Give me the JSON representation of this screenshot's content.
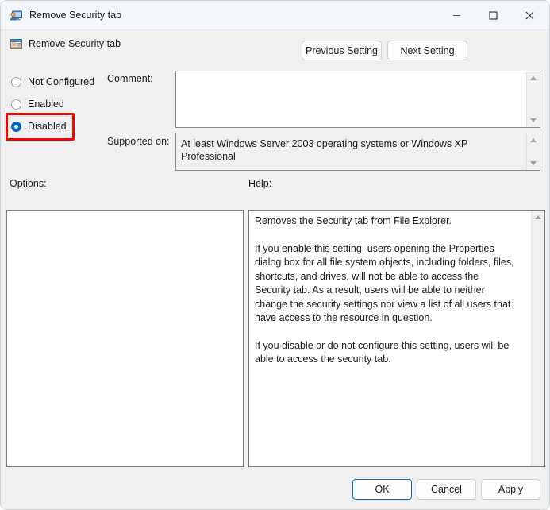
{
  "window": {
    "title": "Remove Security tab",
    "title_icon": "policy-user-monitor-icon",
    "controls": {
      "minimize": "–",
      "maximize": "☐",
      "close": "✕"
    }
  },
  "header": {
    "setting_icon": "policy-setting-icon",
    "setting_name": "Remove Security tab",
    "previous_label": "Previous Setting",
    "next_label": "Next Setting"
  },
  "state_options": {
    "items": [
      {
        "label": "Not Configured",
        "selected": false
      },
      {
        "label": "Enabled",
        "selected": false
      },
      {
        "label": "Disabled",
        "selected": true
      }
    ],
    "highlight_color": "#ff0000",
    "accent_color": "#0067c0"
  },
  "comment": {
    "label": "Comment:",
    "value": "",
    "placeholder": ""
  },
  "supported_on": {
    "label": "Supported on:",
    "value": "At least Windows Server 2003 operating systems or Windows XP Professional"
  },
  "options": {
    "label": "Options:",
    "value": ""
  },
  "help": {
    "label": "Help:",
    "paragraphs": [
      "Removes the Security tab from File Explorer.",
      "If you enable this setting, users opening the Properties dialog box for all file system objects, including folders, files, shortcuts, and drives, will not be able to access the Security tab. As a result, users will be able to neither change the security settings nor view a list of all users that have access to the resource in question.",
      "If you disable or do not configure this setting, users will be able to access the security tab."
    ]
  },
  "footer": {
    "ok_label": "OK",
    "cancel_label": "Cancel",
    "apply_label": "Apply"
  }
}
